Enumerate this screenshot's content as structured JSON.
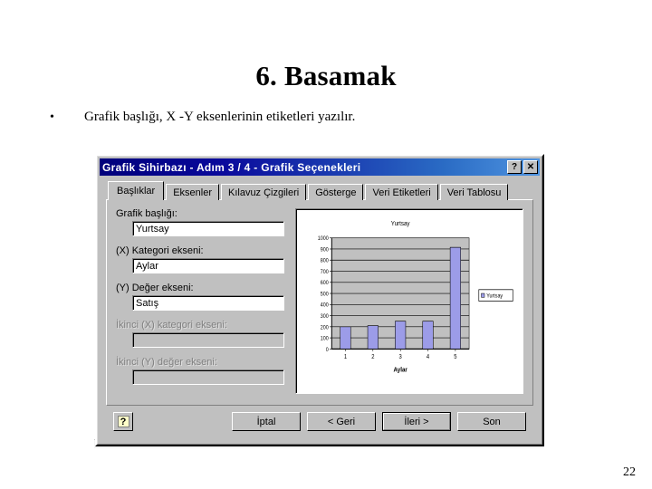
{
  "slide": {
    "title": "6. Basamak",
    "bullet_marker": "•",
    "bullet_text": "Grafik başlığı, X -Y eksenlerinin etiketleri yazılır.",
    "page_number": "22"
  },
  "dialog": {
    "title": "Grafik Sihirbazı - Adım  3 / 4 - Grafik Seçenekleri",
    "help_titlebar_label": "?",
    "close_label": "✕",
    "tabs": [
      {
        "label": "Başlıklar",
        "active": true
      },
      {
        "label": "Eksenler",
        "active": false
      },
      {
        "label": "Kılavuz Çizgileri",
        "active": false
      },
      {
        "label": "Gösterge",
        "active": false
      },
      {
        "label": "Veri Etiketleri",
        "active": false
      },
      {
        "label": "Veri Tablosu",
        "active": false
      }
    ],
    "fields": [
      {
        "label": "Grafik başlığı:",
        "value": "Yurtsay",
        "placeholder": "",
        "disabled": false
      },
      {
        "label": "(X) Kategori ekseni:",
        "value": "Aylar",
        "placeholder": "",
        "disabled": false
      },
      {
        "label": "(Y) Değer ekseni:",
        "value": "Satış",
        "placeholder": "",
        "disabled": false
      },
      {
        "label": "İkinci (X) kategori ekseni:",
        "value": "",
        "placeholder": "",
        "disabled": true
      },
      {
        "label": "İkinci (Y) değer ekseni:",
        "value": "",
        "placeholder": "",
        "disabled": true
      }
    ],
    "buttons": {
      "help": "?",
      "cancel": "İptal",
      "back": "< Geri",
      "next": "İleri >",
      "finish": "Son"
    }
  },
  "chart_data": {
    "type": "bar",
    "title": "Yurtsay",
    "categories": [
      "1",
      "2",
      "3",
      "4",
      "5"
    ],
    "values": [
      200,
      210,
      250,
      250,
      915
    ],
    "series": [
      {
        "name": "Yurtsay",
        "values": [
          200,
          210,
          250,
          250,
          915
        ]
      }
    ],
    "xlabel": "Aylar",
    "ylabel": "",
    "ylim": [
      0,
      1000
    ],
    "yticks": [
      0,
      100,
      200,
      300,
      400,
      500,
      600,
      700,
      800,
      900,
      1000
    ],
    "ytick_labels": [
      "0",
      "100",
      "200",
      "300",
      "400",
      "500",
      "600",
      "700",
      "800",
      "900",
      "1000"
    ],
    "grid": true,
    "legend": [
      "Yurtsay"
    ],
    "legend_position": "right",
    "bar_color": "#9c9ce8",
    "plot_bg_color": "#c0c0c0",
    "chart_bg_color": "#ffffff"
  }
}
